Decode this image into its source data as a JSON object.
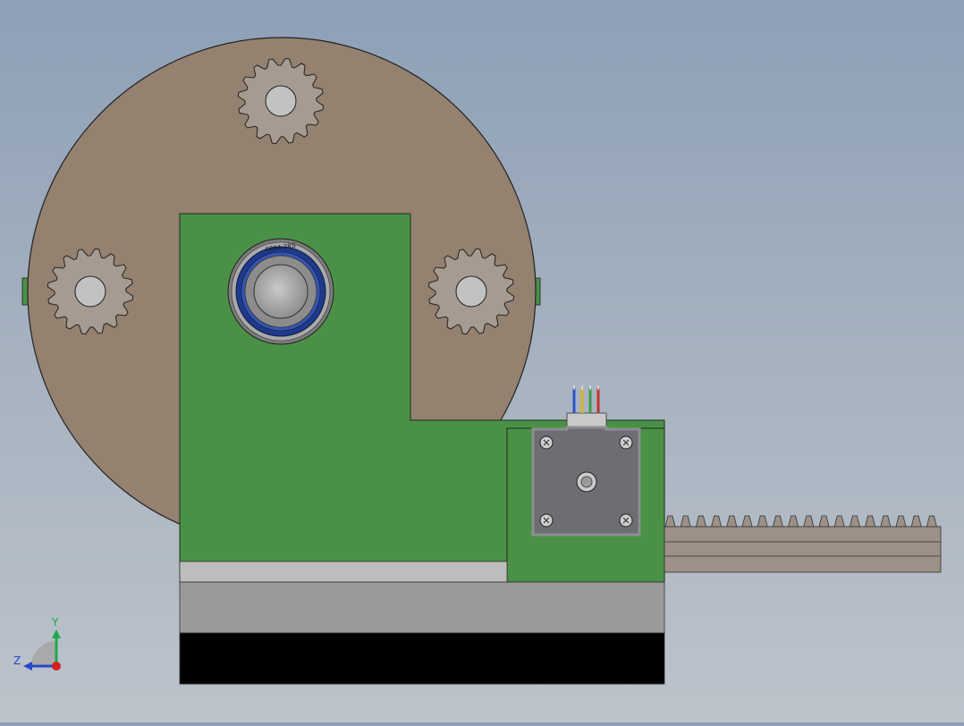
{
  "viewport": {
    "background_top": "#8da0b6",
    "background_bottom": "#bcc3cb"
  },
  "model": {
    "disc_color": "#94816f",
    "gear_color": "#a59b90",
    "bracket_color": "#4a9147",
    "rail_light_color": "#bdbdbd",
    "base_color": "#9a9a9a",
    "base_dark_color": "#000000",
    "motor_color": "#6c6e73",
    "rack_color": "#9c9087",
    "bearing_ring_color": "#1f3a8c",
    "bearing_label": "6804-2RS",
    "motor_wire_colors": [
      "#2d54c4",
      "#d0b62a",
      "#3f9b4a",
      "#c0342d"
    ]
  },
  "triad": {
    "y_label": "Y",
    "z_label": "Z",
    "y_color": "#1fa84a",
    "z_color": "#2848c8",
    "x_color": "#d21f1f"
  }
}
